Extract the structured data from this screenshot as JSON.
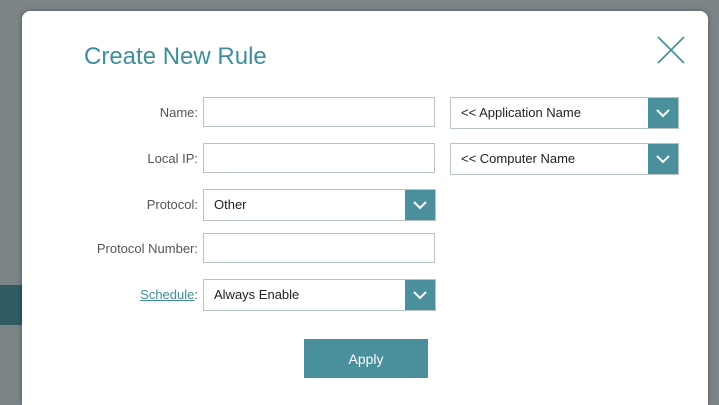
{
  "dialog": {
    "title": "Create New Rule",
    "close_icon": "close-icon"
  },
  "form": {
    "name": {
      "label": "Name:",
      "value": ""
    },
    "local_ip": {
      "label": "Local IP:",
      "value": ""
    },
    "protocol": {
      "label": "Protocol:",
      "selected": "Other"
    },
    "protocol_number": {
      "label": "Protocol Number:",
      "value": ""
    },
    "schedule": {
      "label": "Schedule",
      "colon": ":",
      "selected": "Always Enable"
    },
    "application_select": {
      "selected": "<< Application Name"
    },
    "computer_select": {
      "selected": "<< Computer Name"
    }
  },
  "actions": {
    "apply_label": "Apply"
  },
  "colors": {
    "accent": "#4a8f9c",
    "title": "#3f8f9a",
    "border": "#b7c2c5"
  }
}
